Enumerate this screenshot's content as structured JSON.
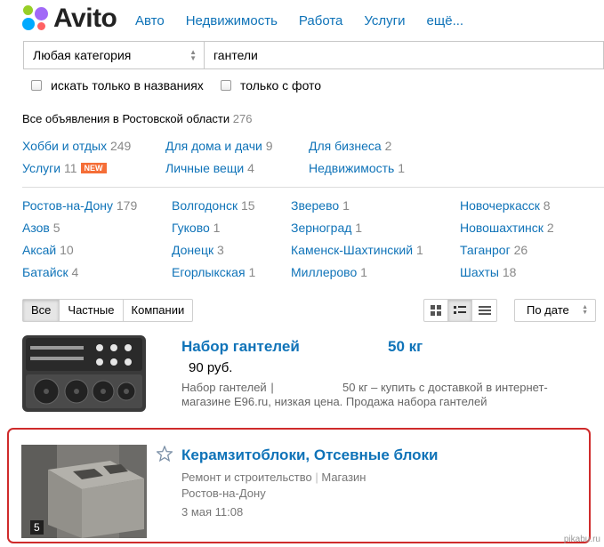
{
  "header": {
    "logo_text": "Avito",
    "nav": [
      "Авто",
      "Недвижимость",
      "Работа",
      "Услуги",
      "ещё..."
    ]
  },
  "search": {
    "category": "Любая категория",
    "query": "гантели"
  },
  "filters": {
    "titles_only": "искать только в названиях",
    "with_photo": "только с фото"
  },
  "region": {
    "label": "Все объявления в Ростовской области",
    "count": "276"
  },
  "categories": [
    {
      "name": "Хобби и отдых",
      "count": "249"
    },
    {
      "name": "Для дома и дачи",
      "count": "9"
    },
    {
      "name": "Для бизнеса",
      "count": "2"
    },
    {
      "name": "Услуги",
      "count": "11",
      "badge": "NEW"
    },
    {
      "name": "Личные вещи",
      "count": "4"
    },
    {
      "name": "Недвижимость",
      "count": "1"
    }
  ],
  "cities": [
    {
      "name": "Ростов-на-Дону",
      "count": "179"
    },
    {
      "name": "Волгодонск",
      "count": "15"
    },
    {
      "name": "Зверево",
      "count": "1"
    },
    {
      "name": "Новочеркасск",
      "count": "8"
    },
    {
      "name": "Азов",
      "count": "5"
    },
    {
      "name": "Гуково",
      "count": "1"
    },
    {
      "name": "Зерноград",
      "count": "1"
    },
    {
      "name": "Новошахтинск",
      "count": "2"
    },
    {
      "name": "Аксай",
      "count": "10"
    },
    {
      "name": "Донецк",
      "count": "3"
    },
    {
      "name": "Каменск-Шахтинский",
      "count": "1"
    },
    {
      "name": "Таганрог",
      "count": "26"
    },
    {
      "name": "Батайск",
      "count": "4"
    },
    {
      "name": "Егорлыкская",
      "count": "1"
    },
    {
      "name": "Миллерово",
      "count": "1"
    },
    {
      "name": "Шахты",
      "count": "18"
    }
  ],
  "seller_tabs": [
    "Все",
    "Частные",
    "Компании"
  ],
  "sort": "По дате",
  "listings": [
    {
      "title_a": "Набор гантелей",
      "title_b": "50 кг",
      "price": "90 руб.",
      "desc_a": "Набор гантелей",
      "desc_b": "50 кг – купить с доставкой в интернет-",
      "desc_line2": "магазине E96.ru, низкая цена. Продажа набора гантелей"
    },
    {
      "title": "Керамзитоблоки, Отсевные блоки",
      "category": "Ремонт и строительство",
      "seller_type": "Магазин",
      "city": "Ростов-на-Дону",
      "date": "3 мая 11:08",
      "photo_count": "5"
    }
  ],
  "watermark": "pikabu.ru"
}
